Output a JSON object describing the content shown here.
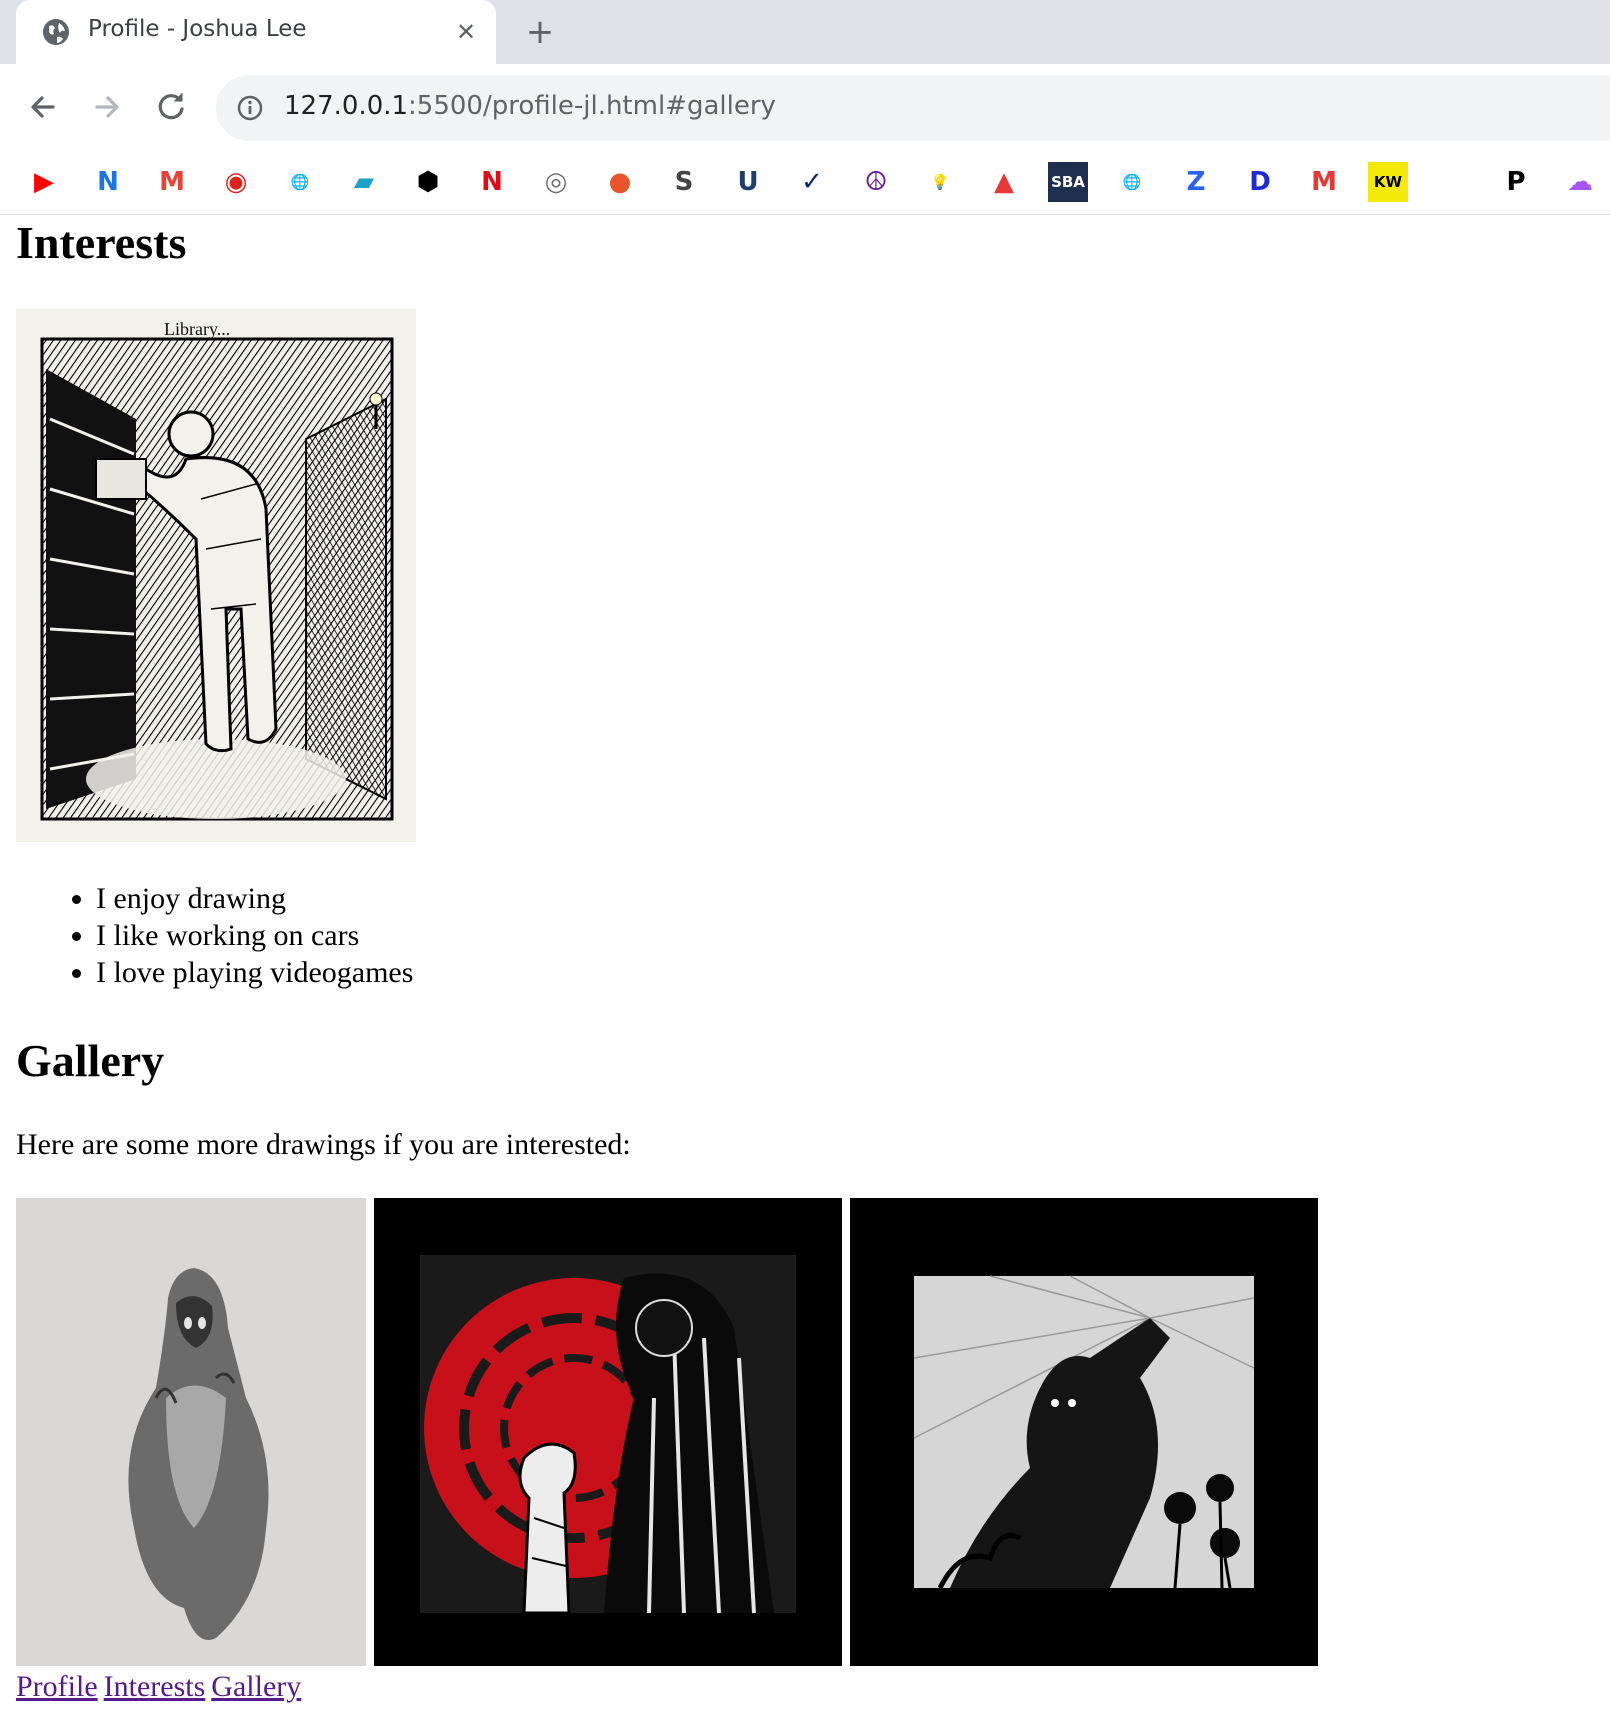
{
  "browser": {
    "tab_title": "Profile - Joshua Lee",
    "tab_close_glyph": "✕",
    "new_tab_glyph": "+",
    "url_host": "127.0.0.1",
    "url_rest": ":5500/profile-jl.html#gallery",
    "bookmarks": [
      {
        "name": "youtube-icon",
        "glyph": "▶",
        "color": "#ff0000"
      },
      {
        "name": "n-icon",
        "glyph": "N",
        "color": "#1a73e8"
      },
      {
        "name": "gmail-icon",
        "glyph": "M",
        "color": "#ea4335"
      },
      {
        "name": "red-circle-icon",
        "glyph": "◉",
        "color": "#e0201b"
      },
      {
        "name": "globe-icon",
        "glyph": "🌐",
        "color": "#5f6368"
      },
      {
        "name": "parallelogram-icon",
        "glyph": "▰",
        "color": "#1ba1c8"
      },
      {
        "name": "black-shield-icon",
        "glyph": "⬢",
        "color": "#000000"
      },
      {
        "name": "netflix-icon",
        "glyph": "N",
        "color": "#e50914"
      },
      {
        "name": "gray-circle-icon",
        "glyph": "◎",
        "color": "#707070"
      },
      {
        "name": "orange-circle-icon",
        "glyph": "●",
        "color": "#e8552b"
      },
      {
        "name": "sp-icon",
        "glyph": "S",
        "color": "#444444"
      },
      {
        "name": "blue-shield-icon",
        "glyph": "U",
        "color": "#1c3e6e"
      },
      {
        "name": "checkmark-box-icon",
        "glyph": "✓",
        "color": "#0a2a66"
      },
      {
        "name": "peace-icon",
        "glyph": "☮",
        "color": "#6a1b9a"
      },
      {
        "name": "lightbulb-icon",
        "glyph": "💡",
        "color": "#f5a623"
      },
      {
        "name": "mountain-icon",
        "glyph": "▲",
        "color": "#e53935"
      },
      {
        "name": "sba-icon",
        "glyph": "SBA",
        "color": "#1f2d4e"
      },
      {
        "name": "globe-icon-2",
        "glyph": "🌐",
        "color": "#5f6368"
      },
      {
        "name": "z-icon",
        "glyph": "Z",
        "color": "#2962ff"
      },
      {
        "name": "disney-icon",
        "glyph": "D",
        "color": "#1e2ad8"
      },
      {
        "name": "mp-icon",
        "glyph": "M",
        "color": "#e53935"
      },
      {
        "name": "kw-icon",
        "glyph": "KW",
        "color": "#f5e90a"
      },
      {
        "name": "p-icon",
        "glyph": "P",
        "color": "#000000"
      },
      {
        "name": "purple-cloud-icon",
        "glyph": "☁",
        "color": "#a855f7"
      }
    ]
  },
  "page": {
    "interests_heading": "Interests",
    "interests_image_caption": "Library...",
    "interests": [
      "I enjoy drawing",
      "I like working on cars",
      "I love playing videogames"
    ],
    "gallery_heading": "Gallery",
    "gallery_text": "Here are some more drawings if you are interested:",
    "footer_links": [
      "Profile",
      "Interests",
      "Gallery"
    ]
  }
}
